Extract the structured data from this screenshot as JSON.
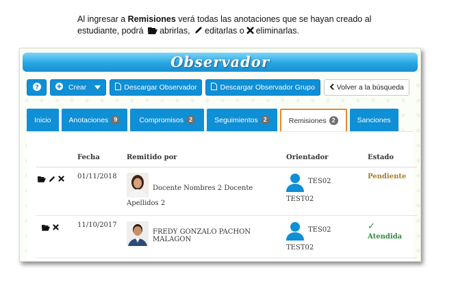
{
  "caption": {
    "part1": "Al ingresar a ",
    "bold": "Remisiones",
    "part2": " verá todas las anotaciones que se hayan creado al estudiante, podrá ",
    "open_text": "abrirlas,",
    "edit_text": "editarlas o",
    "delete_text": "eliminarlas."
  },
  "banner_title": "Observador",
  "toolbar": {
    "help_icon": "question-icon",
    "crear_label": "Crear",
    "descargar_observador": "Descargar Observador",
    "descargar_grupo": "Descargar Observador Grupo",
    "volver": "Volver a la búsqueda"
  },
  "tabs": [
    {
      "label": "Inicio",
      "badge": null
    },
    {
      "label": "Anotaciones",
      "badge": "9"
    },
    {
      "label": "Compromisos",
      "badge": "2"
    },
    {
      "label": "Seguimientos",
      "badge": "2"
    },
    {
      "label": "Remisiones",
      "badge": "2",
      "active": true
    },
    {
      "label": "Sanciones",
      "badge": null
    }
  ],
  "table": {
    "headers": [
      "Fecha",
      "Remitido por",
      "Orientador",
      "Estado"
    ],
    "rows": [
      {
        "fecha": "01/11/2018",
        "remitido": "Docente Nombres 2 Docente Apellidos 2",
        "orientador_top": "TES02",
        "orientador_bottom": "TEST02",
        "estado": "Pendiente",
        "estado_icon": null
      },
      {
        "fecha": "11/10/2017",
        "remitido": "FREDY GONZALO PACHON MALAGON",
        "orientador_top": "TES02",
        "orientador_bottom": "TEST02",
        "estado": "Atendida",
        "estado_icon": "✓"
      }
    ]
  },
  "colors": {
    "primary": "#0f8fd6",
    "active_tab_border": "#e0892c",
    "pending": "#a57c2e",
    "done": "#2e8b3a"
  }
}
